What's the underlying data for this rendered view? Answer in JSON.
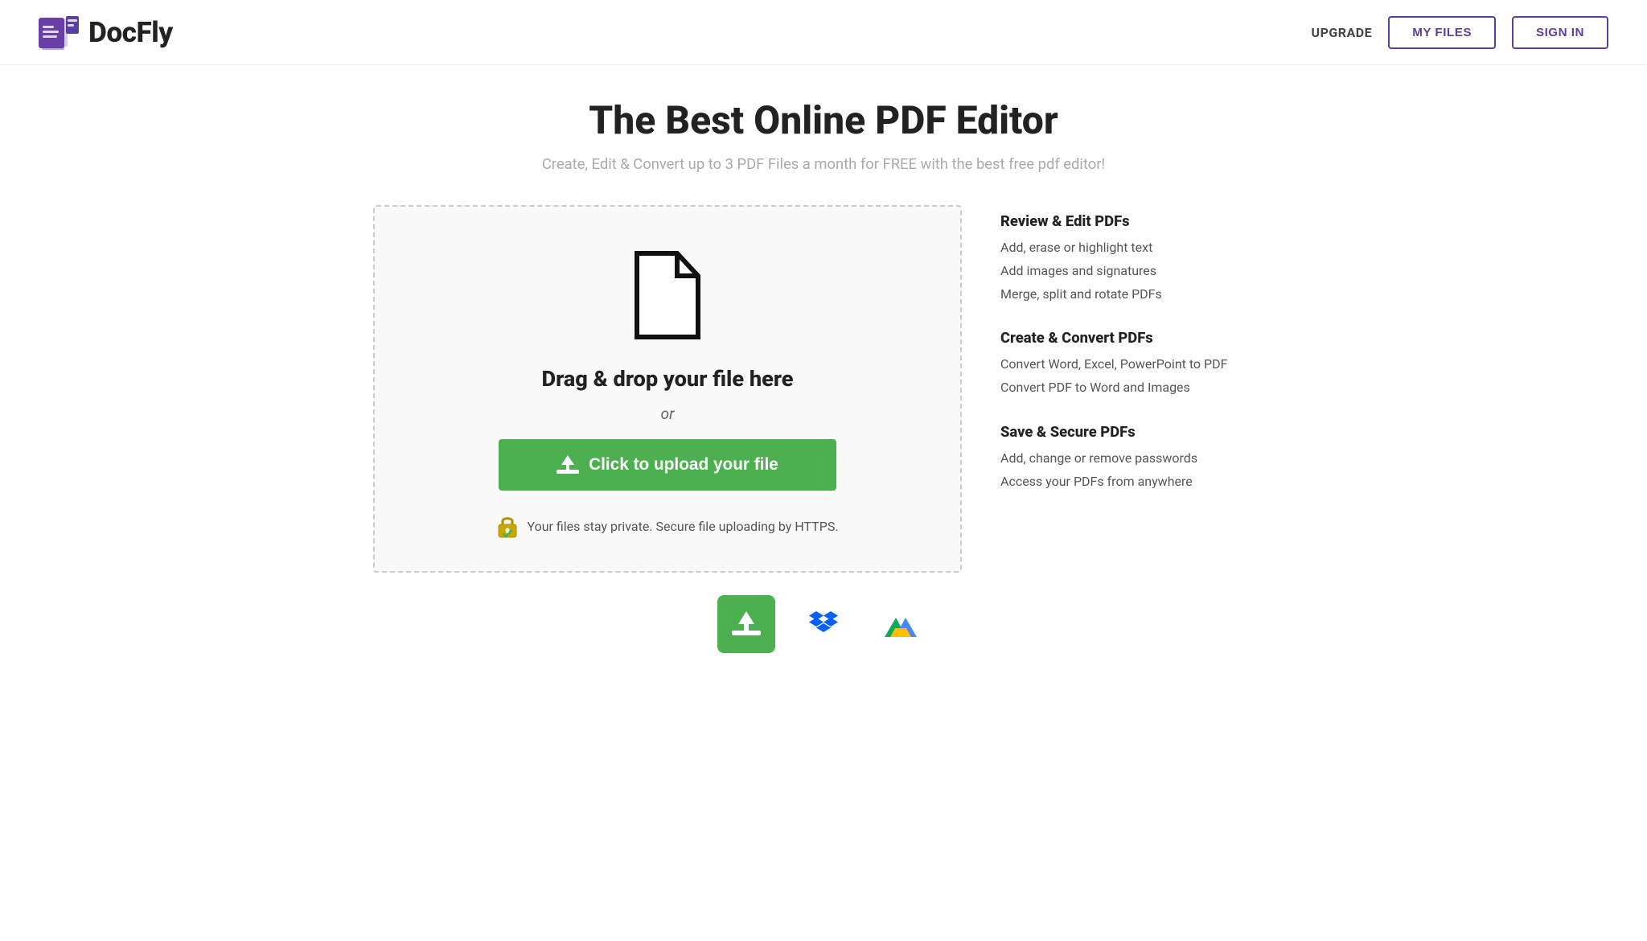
{
  "header": {
    "logo_text": "DocFly",
    "upgrade_label": "UPGRADE",
    "my_files_label": "MY FILES",
    "sign_in_label": "SIGN IN"
  },
  "hero": {
    "title": "The Best Online PDF Editor",
    "subtitle": "Create, Edit & Convert up to 3 PDF Files a month for FREE with the best free pdf editor!"
  },
  "upload": {
    "drag_drop_text": "Drag & drop your file here",
    "or_text": "or",
    "upload_btn_label": "Click to upload your file",
    "security_text": "Your files stay private. Secure file uploading by HTTPS."
  },
  "features": {
    "groups": [
      {
        "title": "Review & Edit PDFs",
        "items": [
          "Add, erase or highlight text",
          "Add images and signatures",
          "Merge, split and rotate PDFs"
        ]
      },
      {
        "title": "Create & Convert PDFs",
        "items": [
          "Convert Word, Excel, PowerPoint to PDF",
          "Convert PDF to Word and Images"
        ]
      },
      {
        "title": "Save & Secure PDFs",
        "items": [
          "Add, change or remove passwords",
          "Access your PDFs from anywhere"
        ]
      }
    ]
  },
  "bottom_icons": {
    "upload_label": "upload-icon",
    "dropbox_label": "dropbox-icon",
    "drive_label": "google-drive-icon"
  },
  "colors": {
    "purple": "#5b3fa0",
    "green": "#4caf50",
    "dark": "#222222",
    "gray_text": "#aaaaaa",
    "border_dashed": "#cccccc"
  }
}
